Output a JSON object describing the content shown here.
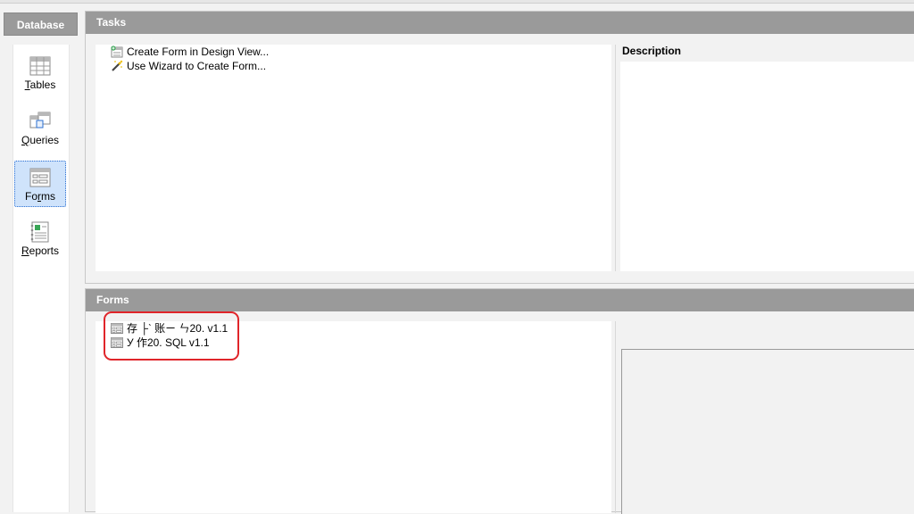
{
  "sidebar": {
    "header": "Database",
    "items": [
      {
        "label_pre": "",
        "label_ul": "T",
        "label_post": "ables",
        "icon": "table-icon"
      },
      {
        "label_pre": "",
        "label_ul": "Q",
        "label_post": "ueries",
        "icon": "query-icon"
      },
      {
        "label_pre": "Fo",
        "label_ul": "r",
        "label_post": "ms",
        "icon": "form-icon",
        "selected": true
      },
      {
        "label_pre": "",
        "label_ul": "R",
        "label_post": "eports",
        "icon": "report-icon"
      }
    ]
  },
  "tasks": {
    "header": "Tasks",
    "items": [
      {
        "label": "Create Form in Design View...",
        "icon": "design-view-icon"
      },
      {
        "label": "Use Wizard to Create Form...",
        "icon": "wizard-icon"
      }
    ],
    "description_header": "Description"
  },
  "forms": {
    "header": "Forms",
    "items": [
      {
        "label": "存 ├ˋ 账ㄧ ㄣ20. v1.1",
        "icon": "form-document-icon"
      },
      {
        "label": "У 作20. SQL v1.1",
        "icon": "form-document-icon"
      }
    ]
  },
  "colors": {
    "header_bg": "#9a9a9a",
    "selected_bg": "#cfe3fb",
    "highlight_ring": "#e0252a"
  }
}
